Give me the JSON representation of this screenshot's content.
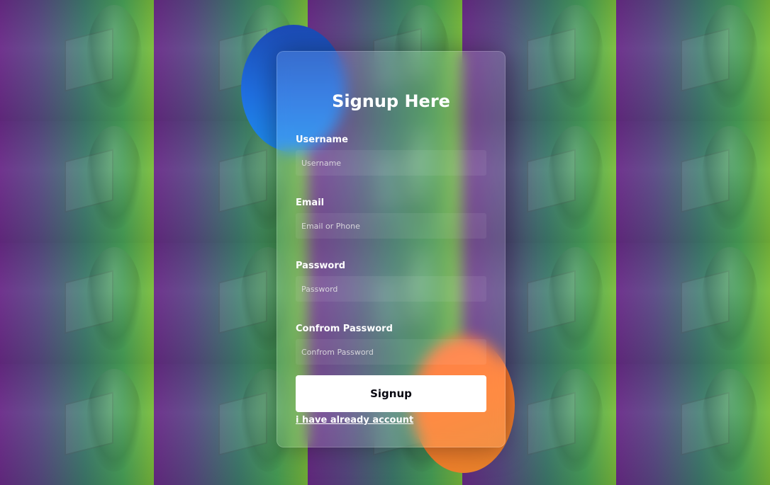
{
  "form": {
    "title": "Signup Here",
    "fields": [
      {
        "label": "Username",
        "placeholder": "Username"
      },
      {
        "label": "Email",
        "placeholder": "Email or Phone"
      },
      {
        "label": "Password",
        "placeholder": "Password"
      },
      {
        "label": "Confrom Password",
        "placeholder": "Confrom Password"
      }
    ],
    "submit_label": "Signup",
    "login_link": "i have already account"
  },
  "colors": {
    "circle_blue": "#1f6fe0",
    "circle_orange": "#ff7c2a",
    "button_bg": "#ffffff",
    "text": "#ffffff"
  }
}
